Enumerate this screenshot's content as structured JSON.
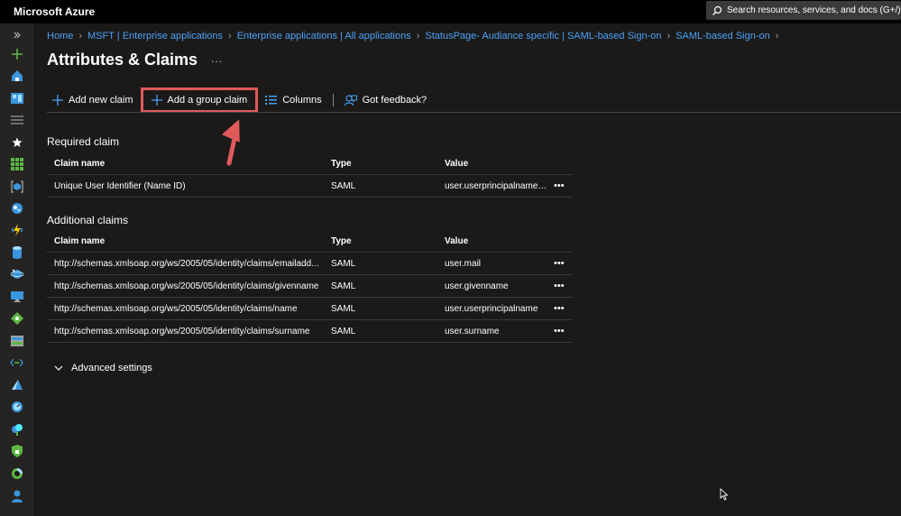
{
  "app": {
    "title": "Microsoft Azure"
  },
  "search": {
    "placeholder": "Search resources, services, and docs (G+/)"
  },
  "breadcrumb": [
    "Home",
    "MSFT | Enterprise applications",
    "Enterprise applications | All applications",
    "StatusPage- Audiance specific | SAML-based Sign-on",
    "SAML-based Sign-on"
  ],
  "page": {
    "title": "Attributes & Claims",
    "more": "..."
  },
  "toolbar": {
    "add_new_claim": "Add new claim",
    "add_group_claim": "Add a group claim",
    "columns": "Columns",
    "feedback": "Got feedback?"
  },
  "columns": {
    "name": "Claim name",
    "type": "Type",
    "value": "Value"
  },
  "required": {
    "title": "Required claim",
    "rows": [
      {
        "name": "Unique User Identifier (Name ID)",
        "type": "SAML",
        "value": "user.userprincipalname [..."
      }
    ]
  },
  "additional": {
    "title": "Additional claims",
    "rows": [
      {
        "name": "http://schemas.xmlsoap.org/ws/2005/05/identity/claims/emailadd...",
        "type": "SAML",
        "value": "user.mail"
      },
      {
        "name": "http://schemas.xmlsoap.org/ws/2005/05/identity/claims/givenname",
        "type": "SAML",
        "value": "user.givenname"
      },
      {
        "name": "http://schemas.xmlsoap.org/ws/2005/05/identity/claims/name",
        "type": "SAML",
        "value": "user.userprincipalname"
      },
      {
        "name": "http://schemas.xmlsoap.org/ws/2005/05/identity/claims/surname",
        "type": "SAML",
        "value": "user.surname"
      }
    ]
  },
  "row_menu": "•••",
  "advanced": {
    "label": "Advanced settings"
  },
  "colors": {
    "accent": "#4ba0f5",
    "highlight": "#e05a5a",
    "background": "#1b1a19"
  },
  "icons": {
    "nav": [
      "expand-icon",
      "create-resource-icon",
      "home-icon",
      "dashboard-icon",
      "all-services-icon",
      "favorites-icon",
      "all-resources-icon",
      "resource-groups-icon",
      "app-services-icon",
      "function-app-icon",
      "sql-database-icon",
      "cosmos-db-icon",
      "virtual-machines-icon",
      "load-balancer-icon",
      "storage-account-icon",
      "virtual-network-icon",
      "azure-ad-icon",
      "monitor-icon",
      "advisor-icon",
      "security-center-icon",
      "cost-management-icon",
      "help-support-icon"
    ]
  }
}
